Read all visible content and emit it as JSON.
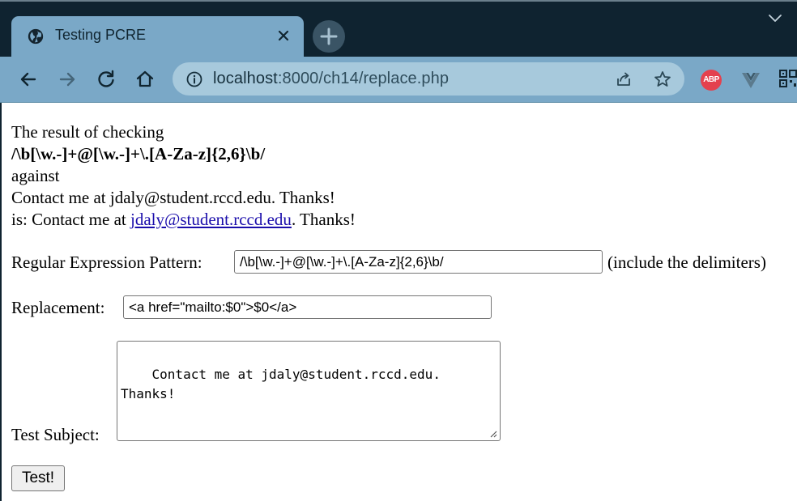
{
  "browser": {
    "tab_title": "Testing PCRE",
    "url_host": "localhost",
    "url_path": ":8000/ch14/replace.php",
    "extensions": {
      "abp_label": "ABP"
    }
  },
  "page": {
    "result": {
      "line1": "The result of checking",
      "pattern": "/\\b[\\w.-]+@[\\w.-]+\\.[A-Za-z]{2,6}\\b/",
      "line3": "against",
      "subject": "Contact me at jdaly@student.rccd.edu. Thanks!",
      "is_prefix": "is: Contact me at ",
      "link_text": "jdaly@student.rccd.edu",
      "is_suffix": ". Thanks!"
    },
    "form": {
      "pattern_label": "Regular Expression Pattern:",
      "pattern_value": "/\\b[\\w.-]+@[\\w.-]+\\.[A-Za-z]{2,6}\\b/",
      "pattern_hint": "(include the delimiters)",
      "replacement_label": "Replacement:",
      "replacement_value": "<a href=\"mailto:$0\">$0</a>",
      "subject_label": "Test Subject:",
      "subject_value": "Contact me at jdaly@student.rccd.edu.\nThanks!",
      "submit_label": "Test!"
    }
  }
}
